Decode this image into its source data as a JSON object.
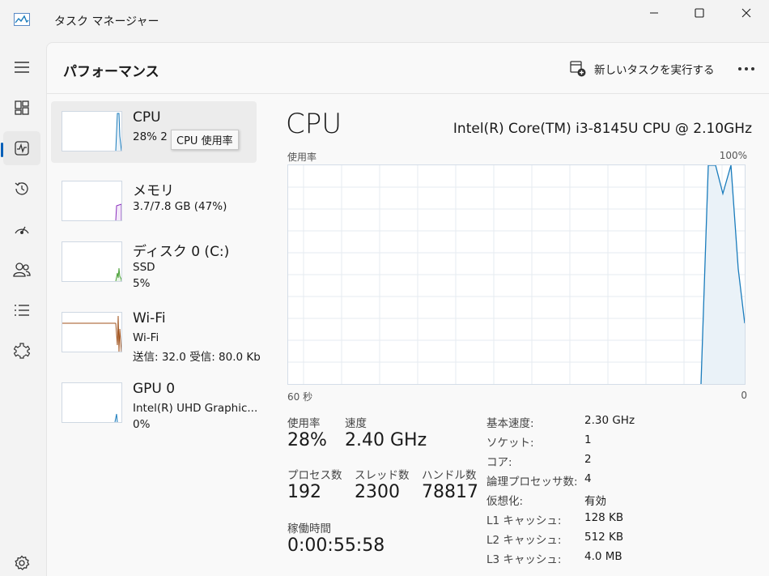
{
  "app": {
    "title": "タスク マネージャー"
  },
  "header": {
    "title": "パフォーマンス",
    "run_task": "新しいタスクを実行する"
  },
  "devices": [
    {
      "name": "CPU",
      "line1": "28% 2",
      "line2": ""
    },
    {
      "name": "メモリ",
      "line1": "3.7/7.8 GB (47%)",
      "line2": ""
    },
    {
      "name": "ディスク 0 (C:)",
      "line1": "SSD",
      "line2": "5%"
    },
    {
      "name": "Wi-Fi",
      "line1": "Wi-Fi",
      "line2": "送信: 32.0 受信: 80.0 Kb"
    },
    {
      "name": "GPU 0",
      "line1": "Intel(R) UHD Graphic...",
      "line2": "0%"
    }
  ],
  "tooltip": "CPU 使用率",
  "detail": {
    "title": "CPU",
    "model": "Intel(R) Core(TM) i3-8145U CPU @ 2.10GHz",
    "chart_left_label": "使用率",
    "chart_right_label": "100%",
    "time_left": "60 秒",
    "time_right": "0"
  },
  "stats": {
    "usage_label": "使用率",
    "usage": "28%",
    "speed_label": "速度",
    "speed": "2.40 GHz",
    "process_label": "プロセス数",
    "processes": "192",
    "thread_label": "スレッド数",
    "threads": "2300",
    "handle_label": "ハンドル数",
    "handles": "78817",
    "uptime_label": "稼働時間",
    "uptime": "0:00:55:58"
  },
  "specs": [
    {
      "label": "基本速度:",
      "value": "2.30 GHz"
    },
    {
      "label": "ソケット:",
      "value": "1"
    },
    {
      "label": "コア:",
      "value": "2"
    },
    {
      "label": "論理プロセッサ数:",
      "value": "4"
    },
    {
      "label": "仮想化:",
      "value": "有効"
    },
    {
      "label": "L1 キャッシュ:",
      "value": "128 KB"
    },
    {
      "label": "L2 キャッシュ:",
      "value": "512 KB"
    },
    {
      "label": "L3 キャッシュ:",
      "value": "4.0 MB"
    }
  ],
  "colors": {
    "accent": "#005fb8",
    "cpu_line": "#1a7cbc",
    "memory_line": "#8b2fbd",
    "disk_line": "#4ca13a",
    "wifi_line": "#a0521c"
  },
  "icons": {
    "app": "task-manager-icon",
    "nav": [
      "hamburger-icon",
      "processes-icon",
      "performance-icon",
      "app-history-icon",
      "startup-apps-icon",
      "users-icon",
      "details-icon",
      "services-icon",
      "settings-icon"
    ]
  }
}
